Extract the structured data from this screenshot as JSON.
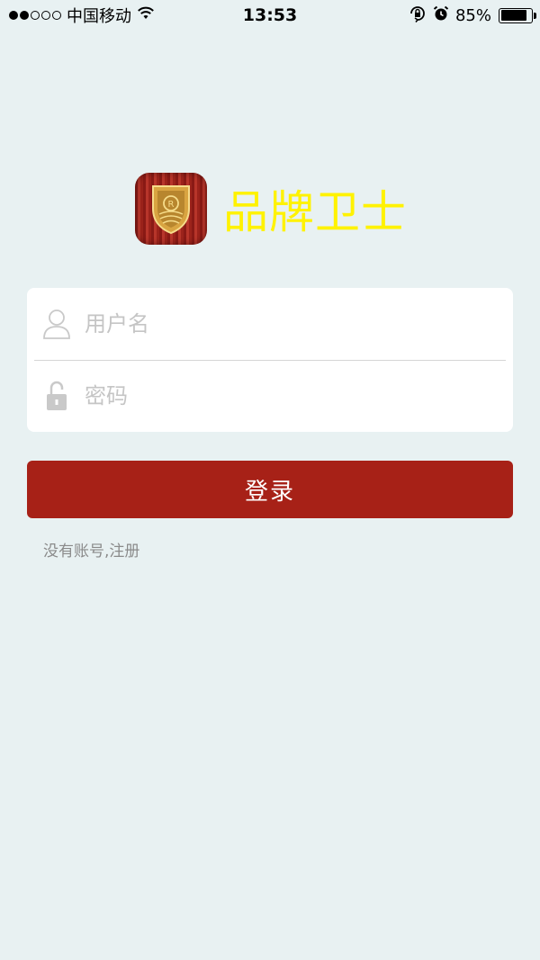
{
  "status_bar": {
    "carrier": "中国移动",
    "time": "13:53",
    "battery": "85%",
    "battery_level": 0.85,
    "signal_strength": 2,
    "signal_total": 5
  },
  "brand": {
    "name": "品牌卫士",
    "logo_icon": "shield-r-icon",
    "name_color": "#fff200"
  },
  "form": {
    "username_placeholder": "用户名",
    "password_placeholder": "密码",
    "login_label": "登录",
    "register_label": "没有账号,注册"
  },
  "colors": {
    "background": "#e8f1f2",
    "accent": "#a72117"
  }
}
